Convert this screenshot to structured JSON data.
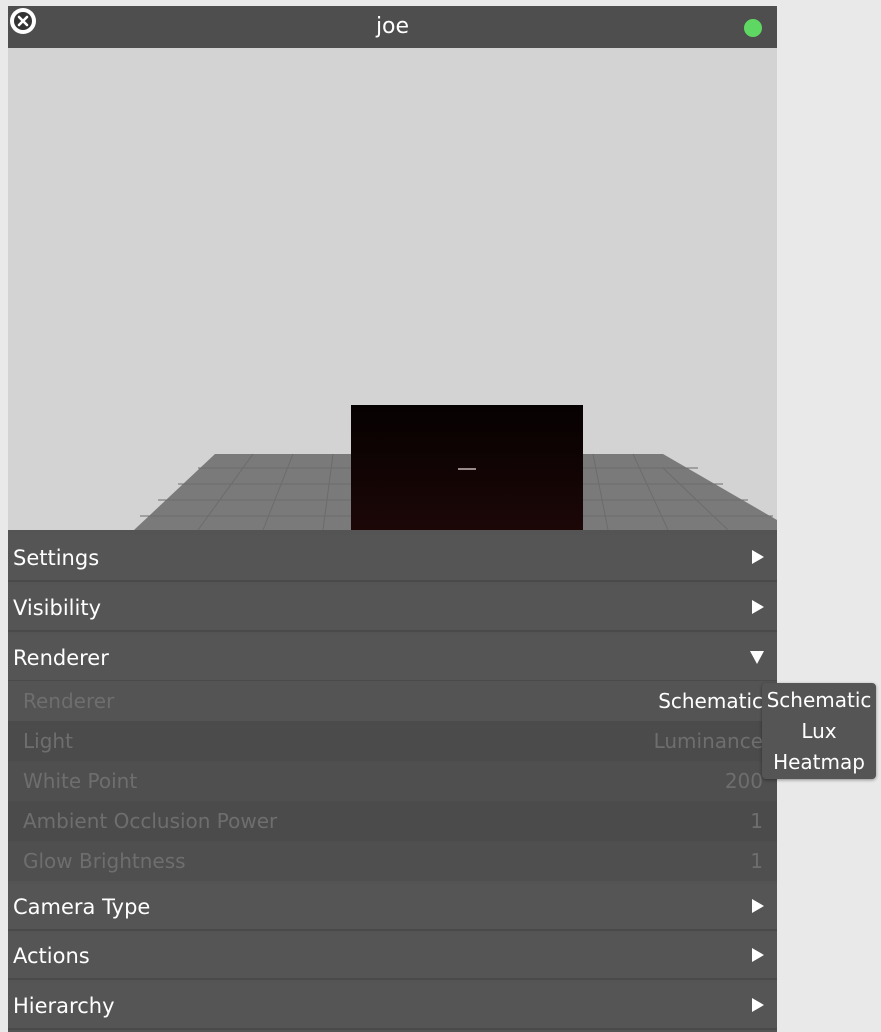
{
  "window": {
    "title": "joe",
    "status_color": "#5fd863",
    "accent_color": "#555555"
  },
  "icons": {
    "close": "close-icon",
    "status": "status-dot-icon",
    "collapsed": "triangle-right-icon",
    "expanded": "triangle-down-icon"
  },
  "sections": {
    "settings": "Settings",
    "visibility": "Visibility",
    "renderer": "Renderer",
    "camera_type": "Camera Type",
    "actions": "Actions",
    "hierarchy": "Hierarchy"
  },
  "renderer_rows": [
    {
      "label": "Renderer",
      "value": "Schematic"
    },
    {
      "label": "Light",
      "value": "Luminance"
    },
    {
      "label": "White Point",
      "value": "200"
    },
    {
      "label": "Ambient Occlusion Power",
      "value": "1"
    },
    {
      "label": "Glow Brightness",
      "value": "1"
    }
  ],
  "renderer_dropdown": {
    "options": [
      "Schematic",
      "Lux",
      "Heatmap"
    ]
  }
}
